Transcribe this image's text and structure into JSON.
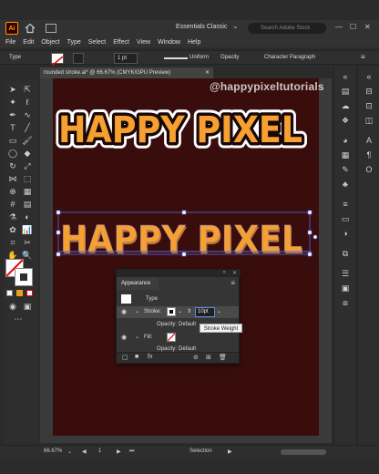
{
  "app": {
    "logo": "Ai",
    "workspace": "Essentials Classic",
    "search_placeholder": "Search Adobe Stock"
  },
  "menu": [
    "File",
    "Edit",
    "Object",
    "Type",
    "Select",
    "Effect",
    "View",
    "Window",
    "Help"
  ],
  "control": {
    "label": "Type",
    "stroke_weight": "1 pt",
    "profile": "Uniform",
    "opacity_label": "Opacity",
    "character_label": "Character",
    "paragraph_label": "Paragraph"
  },
  "document": {
    "tab_title": "rounded stroke.ai* @ 66.67% (CMYK/GPU Preview)"
  },
  "canvas": {
    "watermark": "@happypixeltutorials",
    "text_top": "HAPPY PIXEL",
    "text_bottom": "HAPPY PIXEL"
  },
  "appearance": {
    "title": "Appearance",
    "type_label": "Type",
    "stroke_label": "Stroke:",
    "stroke_value": "10pt",
    "opacity_label": "Opacity:",
    "opacity_value": "Default",
    "fill_label": "Fill:",
    "opacity2_label": "Opacity:",
    "opacity2_value": "Default"
  },
  "tooltip": "Stroke Weight",
  "status": {
    "zoom": "66.67%",
    "artboard": "1",
    "tool": "Selection"
  },
  "colors": {
    "artboard": "#3a0d0d",
    "orange": "#f5a030",
    "accent": "#ff9a00"
  }
}
